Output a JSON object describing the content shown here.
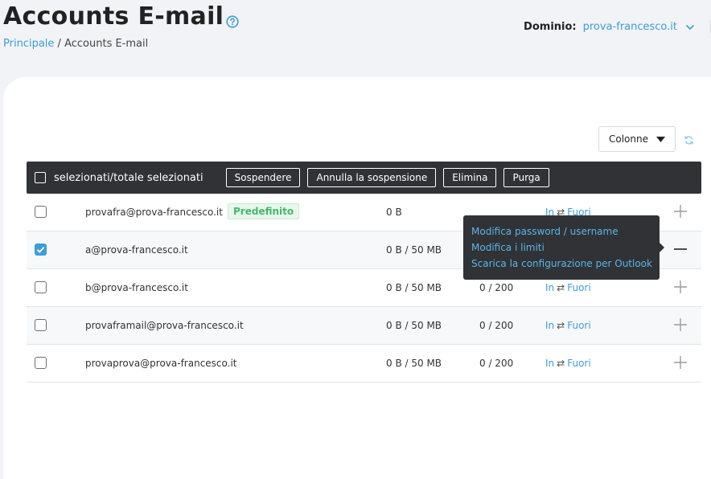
{
  "header": {
    "title": "Accounts E-mail",
    "breadcrumb": {
      "home": "Principale",
      "separator": "/",
      "current": "Accounts E-mail"
    },
    "domain_label": "Dominio:",
    "domain_value": "prova-francesco.it"
  },
  "controls": {
    "columns_label": "Colonne"
  },
  "toolbar": {
    "selection_label": "selezionati/totale selezionati",
    "buttons": [
      "Sospendere",
      "Annulla la sospensione",
      "Elimina",
      "Purga"
    ]
  },
  "accounts": [
    {
      "email": "provafra@prova-francesco.it",
      "badge": "Predefinito",
      "size": "0 B",
      "quota": "",
      "in": "In",
      "out": "Fuori",
      "checked": false
    },
    {
      "email": "a@prova-francesco.it",
      "badge": "",
      "size": "0 B / 50 MB",
      "quota": "",
      "in": "",
      "out": "",
      "checked": true
    },
    {
      "email": "b@prova-francesco.it",
      "badge": "",
      "size": "0 B / 50 MB",
      "quota": "0 / 200",
      "in": "In",
      "out": "Fuori",
      "checked": false
    },
    {
      "email": "provaframail@prova-francesco.it",
      "badge": "",
      "size": "0 B / 50 MB",
      "quota": "0 / 200",
      "in": "In",
      "out": "Fuori",
      "checked": false
    },
    {
      "email": "provaprova@prova-francesco.it",
      "badge": "",
      "size": "0 B / 50 MB",
      "quota": "0 / 200",
      "in": "In",
      "out": "Fuori",
      "checked": false
    }
  ],
  "io_separator": "⇄",
  "context_menu": {
    "items": [
      "Modifica password / username",
      "Modifica i limiti",
      "Scarica la configurazione per Outlook"
    ]
  },
  "colors": {
    "accent": "#3a9ed8",
    "toolbar_bg": "#303236",
    "badge_green": "#44b86a"
  },
  "icons": [
    "help-circle-icon",
    "chevron-down-icon",
    "caret-down-icon",
    "refresh-icon",
    "plus-icon",
    "minus-icon",
    "check-icon"
  ]
}
